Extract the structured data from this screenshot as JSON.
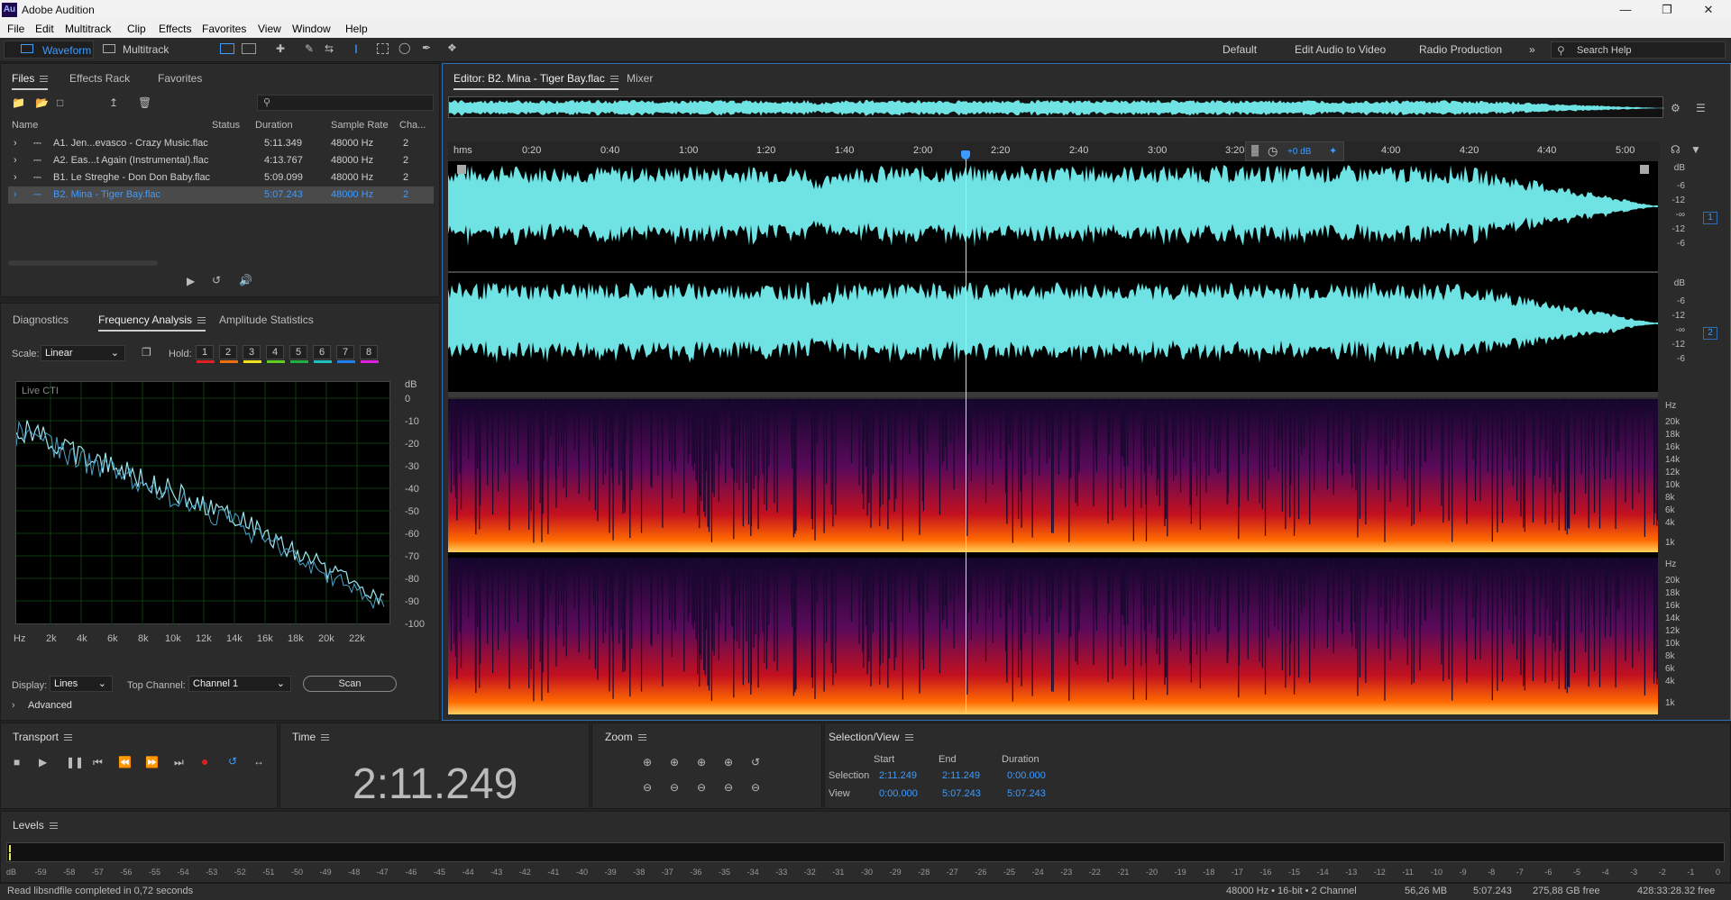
{
  "window": {
    "title": "Adobe Audition",
    "logo": "Au"
  },
  "menu": [
    "File",
    "Edit",
    "Multitrack",
    "Clip",
    "Effects",
    "Favorites",
    "View",
    "Window",
    "Help"
  ],
  "toolbar": {
    "waveform": "Waveform",
    "multitrack": "Multitrack"
  },
  "workspaces": [
    "Default",
    "Edit Audio to Video",
    "Radio Production"
  ],
  "search_help": "Search Help",
  "files_panel": {
    "tabs": [
      "Files",
      "Effects Rack",
      "Favorites"
    ],
    "columns": [
      "Name",
      "Status",
      "Duration",
      "Sample Rate",
      "Cha..."
    ],
    "rows": [
      {
        "name": "A1. Jen...evasco - Crazy Music.flac",
        "duration": "5:11.349",
        "rate": "48000 Hz",
        "ch": "2"
      },
      {
        "name": "A2. Eas...t Again (Instrumental).flac",
        "duration": "4:13.767",
        "rate": "48000 Hz",
        "ch": "2"
      },
      {
        "name": "B1. Le Streghe - Don Don Baby.flac",
        "duration": "5:09.099",
        "rate": "48000 Hz",
        "ch": "2"
      },
      {
        "name": "B2. Mina - Tiger Bay.flac",
        "duration": "5:07.243",
        "rate": "48000 Hz",
        "ch": "2"
      }
    ]
  },
  "analysis_panel": {
    "tabs": [
      "Diagnostics",
      "Frequency Analysis",
      "Amplitude Statistics"
    ],
    "scale_label": "Scale:",
    "scale_value": "Linear",
    "hold_label": "Hold:",
    "hold": [
      "1",
      "2",
      "3",
      "4",
      "5",
      "6",
      "7",
      "8"
    ],
    "hold_colors": [
      "#e02020",
      "#f07010",
      "#f0e020",
      "#60d020",
      "#20b040",
      "#20c0c0",
      "#2080f0",
      "#e020e0"
    ],
    "live_cti": "Live CTI",
    "db_unit": "dB",
    "db_ticks": [
      "0",
      "-10",
      "-20",
      "-30",
      "-40",
      "-50",
      "-60",
      "-70",
      "-80",
      "-90",
      "-100"
    ],
    "hz_ticks": [
      "Hz",
      "2k",
      "4k",
      "6k",
      "8k",
      "10k",
      "12k",
      "14k",
      "16k",
      "18k",
      "20k",
      "22k"
    ],
    "display_label": "Display:",
    "display_value": "Lines",
    "top_channel_label": "Top Channel:",
    "top_channel_value": "Channel 1",
    "scan": "Scan",
    "advanced": "Advanced"
  },
  "editor": {
    "tabs": [
      "Editor: B2. Mina - Tiger Bay.flac",
      "Mixer"
    ],
    "ruler": [
      "hms",
      "0:20",
      "0:40",
      "1:00",
      "1:20",
      "1:40",
      "2:00",
      "2:20",
      "2:40",
      "3:00",
      "3:20",
      "4:00",
      "4:20",
      "4:40",
      "5:00"
    ],
    "gain": "+0 dB",
    "db_labels": [
      "dB",
      "-6",
      "-12",
      "-∞",
      "-12",
      "-6"
    ],
    "channels": [
      "1",
      "2"
    ],
    "hz_labels": [
      "Hz",
      "20k",
      "18k",
      "16k",
      "14k",
      "12k",
      "10k",
      "8k",
      "6k",
      "4k",
      "1k"
    ],
    "playhead_fraction": 0.428
  },
  "transport": {
    "title": "Transport"
  },
  "time": {
    "title": "Time",
    "value": "2:11.249"
  },
  "zoom": {
    "title": "Zoom"
  },
  "selection": {
    "title": "Selection/View",
    "headers": [
      "Start",
      "End",
      "Duration"
    ],
    "rows": [
      {
        "label": "Selection",
        "start": "2:11.249",
        "end": "2:11.249",
        "duration": "0:00.000"
      },
      {
        "label": "View",
        "start": "0:00.000",
        "end": "5:07.243",
        "duration": "5:07.243"
      }
    ]
  },
  "levels": {
    "title": "Levels",
    "ticks": [
      "dB",
      "-59",
      "-58",
      "-57",
      "-56",
      "-55",
      "-54",
      "-53",
      "-52",
      "-51",
      "-50",
      "-49",
      "-48",
      "-47",
      "-46",
      "-45",
      "-44",
      "-43",
      "-42",
      "-41",
      "-40",
      "-39",
      "-38",
      "-37",
      "-36",
      "-35",
      "-34",
      "-33",
      "-32",
      "-31",
      "-30",
      "-29",
      "-28",
      "-27",
      "-26",
      "-25",
      "-24",
      "-23",
      "-22",
      "-21",
      "-20",
      "-19",
      "-18",
      "-17",
      "-16",
      "-15",
      "-14",
      "-13",
      "-12",
      "-11",
      "-10",
      "-9",
      "-8",
      "-7",
      "-6",
      "-5",
      "-4",
      "-3",
      "-2",
      "-1",
      "0"
    ]
  },
  "status": {
    "message": "Read libsndfile completed in 0,72 seconds",
    "format": "48000 Hz • 16-bit • 2 Channel",
    "size": "56,26 MB",
    "duration": "5:07.243",
    "free": "275,88 GB free",
    "free_time": "428:33:28.32 free"
  },
  "colors": {
    "waveform": "#6fe3e3",
    "accent": "#3d9cff",
    "playhead": "#e8e860"
  }
}
